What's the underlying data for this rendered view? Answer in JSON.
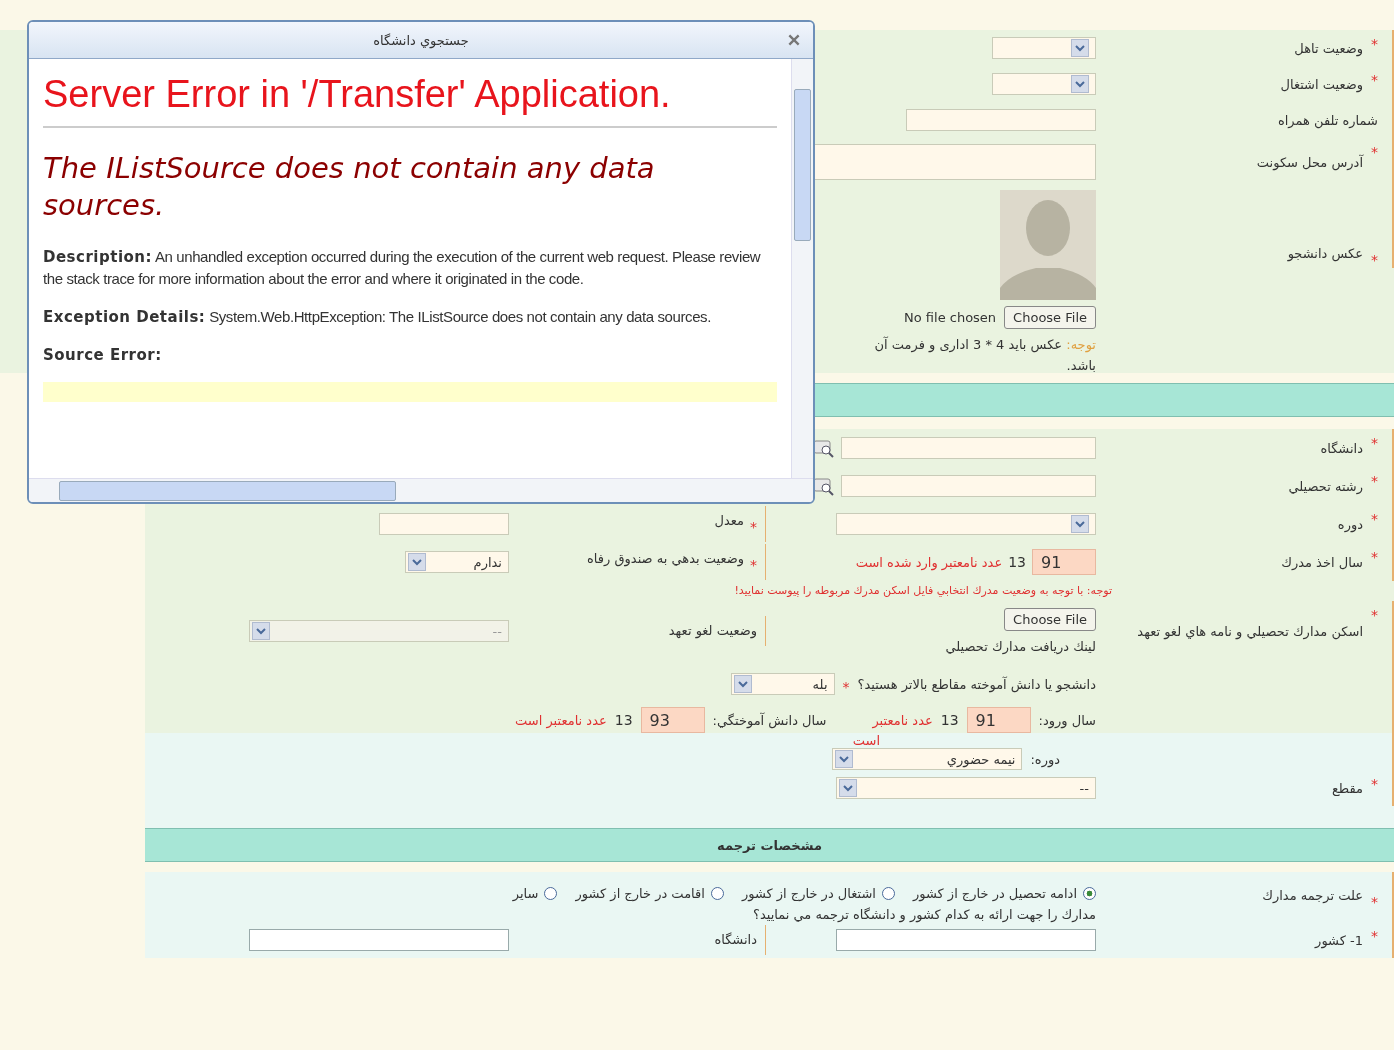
{
  "required_mark": "*",
  "dialog": {
    "title": "جستجوي دانشگاه",
    "heading": "Server Error in '/Transfer' Application.",
    "subheading": "The IListSource does not contain any data sources.",
    "description_label": "Description:",
    "description": "An unhandled exception occurred during the execution of the current web request. Please review the stack trace for more information about the error and where it originated in the code.",
    "exception_label": "Exception Details:",
    "exception": "System.Web.HttpException: The IListSource does not contain any data sources.",
    "source_error_label": "Source Error:"
  },
  "personal": {
    "rows": [
      {
        "label": "وضعيت تاهل",
        "required": true,
        "kind": "select"
      },
      {
        "label": "وضعيت اشتغال",
        "required": true,
        "kind": "select"
      },
      {
        "label": "شماره تلفن همراه",
        "required": false,
        "kind": "input"
      },
      {
        "label": "آدرس محل سکونت",
        "required": true,
        "kind": "textarea"
      },
      {
        "label": "عکس دانشجو",
        "required": true,
        "kind": "photo"
      }
    ],
    "photo": {
      "button": "Choose File",
      "status": "No file chosen",
      "note_label": "توجه:",
      "note": "عکس باید 4 * 3 اداری و فرمت آن",
      "note_end": "باشد."
    }
  },
  "education": {
    "university": {
      "label": "دانشگاه",
      "required": true
    },
    "major": {
      "label": "رشته تحصيلي",
      "required": true
    },
    "period": {
      "label": "دوره",
      "required": true
    },
    "gpa": {
      "label": "معدل",
      "required": true
    },
    "year": {
      "label": "سال اخذ مدرك",
      "required": true,
      "value": "91",
      "prefix": "13",
      "error": "عدد نامعتبر وارد شده است"
    },
    "debt": {
      "label": "وضعيت بدهي به صندوق رفاه",
      "required": true,
      "value": "ندارم"
    },
    "note": "توجه: با توجه به وضعيت مدرك انتخابي فايل اسكن مدرك مربوطه را پيوست نماييد!",
    "scan": {
      "label": "اسكن مدارك تحصيلي و نامه هاي لغو تعهد",
      "required": true,
      "button": "Choose File",
      "link": "لينك دريافت مدارك تحصيلي"
    },
    "cancel": {
      "label": "وضعيت لغو تعهد",
      "value": "--",
      "disabled": true
    },
    "higher": {
      "question": "دانشجو يا دانش آموخته مقاطع بالاتر هستيد؟",
      "required": true,
      "value": "بله"
    },
    "entry": {
      "label": "سال ورود:",
      "value": "91",
      "prefix": "13",
      "error": "عدد نامعتبر",
      "error_end": "است"
    },
    "grad": {
      "label": "سال دانش آموختگي:",
      "value": "93",
      "prefix": "13",
      "error": "عدد نامعتبر است"
    },
    "course": {
      "label": "دوره:",
      "value": "نيمه حضوري"
    },
    "level": {
      "label": "مقطع",
      "required": true,
      "value": "--"
    }
  },
  "translation": {
    "title": "مشخصات ترجمه",
    "reason": {
      "label": "علت ترجمه مدارك",
      "required": true,
      "options": [
        {
          "label": "ادامه تحصيل در خارج از كشور",
          "selected": true
        },
        {
          "label": "اشتغال در خارج از كشور",
          "selected": false
        },
        {
          "label": "اقامت در خارج از كشور",
          "selected": false
        },
        {
          "label": "ساير",
          "selected": false
        }
      ]
    },
    "question": "مدارك را جهت ارائه به كدام كشور و دانشگاه ترجمه مي نماييد؟",
    "country": {
      "label": "1- كشور",
      "required": true
    },
    "university": {
      "label": "دانشگاه"
    }
  }
}
